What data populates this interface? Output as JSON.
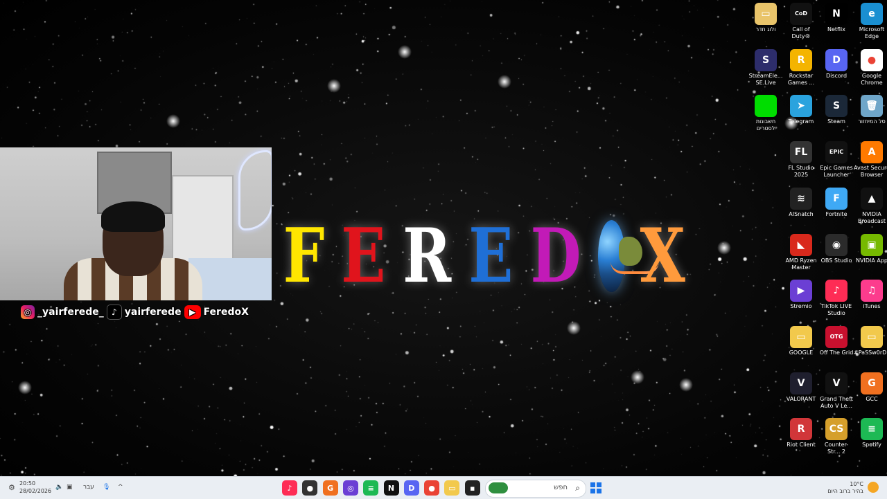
{
  "wallpaper": {
    "title_letters": [
      {
        "char": "F",
        "color": "#ffe600"
      },
      {
        "char": "E",
        "color": "#e0141c"
      },
      {
        "char": "R",
        "color": "#ffffff"
      },
      {
        "char": "E",
        "color": "#1f6fd6"
      },
      {
        "char": "D",
        "color": "#c21ab7"
      },
      {
        "char": "X",
        "color": "#ff9a3c"
      }
    ]
  },
  "socials": {
    "instagram": "_yairferede_",
    "tiktok": "yairferede",
    "youtube": "FeredoX"
  },
  "desktop_icons": [
    {
      "id": "folder-hebrew",
      "label": "ולוג חדר",
      "color": "#e9c46a",
      "glyph": "▭"
    },
    {
      "id": "call-of-duty",
      "label": "Call of Duty®",
      "color": "#111111",
      "glyph": "CoD"
    },
    {
      "id": "netflix",
      "label": "Netflix",
      "color": "#000000",
      "glyph": "N"
    },
    {
      "id": "microsoft-edge",
      "label": "Microsoft Edge",
      "color": "#1a8fd1",
      "glyph": "e"
    },
    {
      "id": "streamelements",
      "label": "StreamEle... SE.Live",
      "color": "#2d2d6b",
      "glyph": "S"
    },
    {
      "id": "rockstar-games",
      "label": "Rockstar Games ...",
      "color": "#f4b400",
      "glyph": "R"
    },
    {
      "id": "discord",
      "label": "Discord",
      "color": "#5865f2",
      "glyph": "D"
    },
    {
      "id": "google-chrome",
      "label": "Google Chrome",
      "color": "#ffffff",
      "glyph": "●"
    },
    {
      "id": "green-shortcut",
      "label": "חשבונות לסטרים",
      "color": "#00dd00",
      "glyph": ""
    },
    {
      "id": "telegram",
      "label": "Telegram",
      "color": "#2aa3de",
      "glyph": "➤"
    },
    {
      "id": "steam",
      "label": "Steam",
      "color": "#1b2838",
      "glyph": "S"
    },
    {
      "id": "recycle-bin",
      "label": "סל המיחזור",
      "color": "#6fa6c9",
      "glyph": "🗑"
    },
    {
      "id": "fl-studio",
      "label": "FL Studio 2025",
      "color": "#333333",
      "glyph": "FL"
    },
    {
      "id": "epic-games",
      "label": "Epic Games Launcher",
      "color": "#111111",
      "glyph": "EPIC"
    },
    {
      "id": "avast-browser",
      "label": "Avast Secure Browser",
      "color": "#ff7a00",
      "glyph": "A"
    },
    {
      "id": "aisnatch",
      "label": "AISnatch",
      "color": "#222222",
      "glyph": "≋"
    },
    {
      "id": "fortnite",
      "label": "Fortnite",
      "color": "#3fa9f5",
      "glyph": "F"
    },
    {
      "id": "nvidia-broadcast",
      "label": "NVIDIA Broadcast",
      "color": "#111111",
      "glyph": "▲"
    },
    {
      "id": "amd-ryzen",
      "label": "AMD Ryzen Master",
      "color": "#d9291c",
      "glyph": "◣"
    },
    {
      "id": "obs-studio",
      "label": "OBS Studio",
      "color": "#2b2b2b",
      "glyph": "◉"
    },
    {
      "id": "nvidia-app",
      "label": "NVIDIA App",
      "color": "#76b900",
      "glyph": "▣"
    },
    {
      "id": "stremio",
      "label": "Stremio",
      "color": "#6b3fd4",
      "glyph": "▶"
    },
    {
      "id": "tiktok-live",
      "label": "TikTok LIVE Studio",
      "color": "#fe2c55",
      "glyph": "♪"
    },
    {
      "id": "itunes",
      "label": "iTunes",
      "color": "#fc3c8d",
      "glyph": "♫"
    },
    {
      "id": "google-folder",
      "label": "GOOGLE",
      "color": "#f2c94c",
      "glyph": "▭"
    },
    {
      "id": "off-the-grid",
      "label": "Off The Grid",
      "color": "#c8102e",
      "glyph": "OTG"
    },
    {
      "id": "password-folder",
      "label": "#PaSSw0rD...",
      "color": "#f2c94c",
      "glyph": "▭"
    },
    {
      "id": "valorant",
      "label": "VALORANT",
      "color": "#1f1f2e",
      "glyph": "V"
    },
    {
      "id": "gta-v",
      "label": "Grand Theft Auto V Le...",
      "color": "#111111",
      "glyph": "V"
    },
    {
      "id": "gcc",
      "label": "GCC",
      "color": "#f07020",
      "glyph": "G"
    },
    {
      "id": "riot-client",
      "label": "Riot Client",
      "color": "#d13639",
      "glyph": "R"
    },
    {
      "id": "counter-strike",
      "label": "Counter-Str... 2",
      "color": "#d59f2b",
      "glyph": "CS"
    },
    {
      "id": "spotify",
      "label": "Spotify",
      "color": "#1db954",
      "glyph": "≡"
    }
  ],
  "taskbar": {
    "time": "20:50",
    "date": "28/02/2026",
    "language": "עבר",
    "search_placeholder": "חפש",
    "weather_temp": "10°C",
    "weather_desc": "בהיר ברוב היום",
    "apps": [
      {
        "id": "tiktok",
        "color": "#fe2c55",
        "glyph": "♪"
      },
      {
        "id": "recorder",
        "color": "#333333",
        "glyph": "●"
      },
      {
        "id": "gcc",
        "color": "#f07020",
        "glyph": "G"
      },
      {
        "id": "stremio",
        "color": "#6b3fd4",
        "glyph": "◎"
      },
      {
        "id": "spotify",
        "color": "#1db954",
        "glyph": "≡"
      },
      {
        "id": "netflix",
        "color": "#111111",
        "glyph": "N"
      },
      {
        "id": "discord",
        "color": "#5865f2",
        "glyph": "D"
      },
      {
        "id": "chrome",
        "color": "#ea4335",
        "glyph": "●"
      },
      {
        "id": "file-explorer",
        "color": "#f2c94c",
        "glyph": "▭"
      },
      {
        "id": "terminal",
        "color": "#222222",
        "glyph": "▪"
      }
    ]
  }
}
